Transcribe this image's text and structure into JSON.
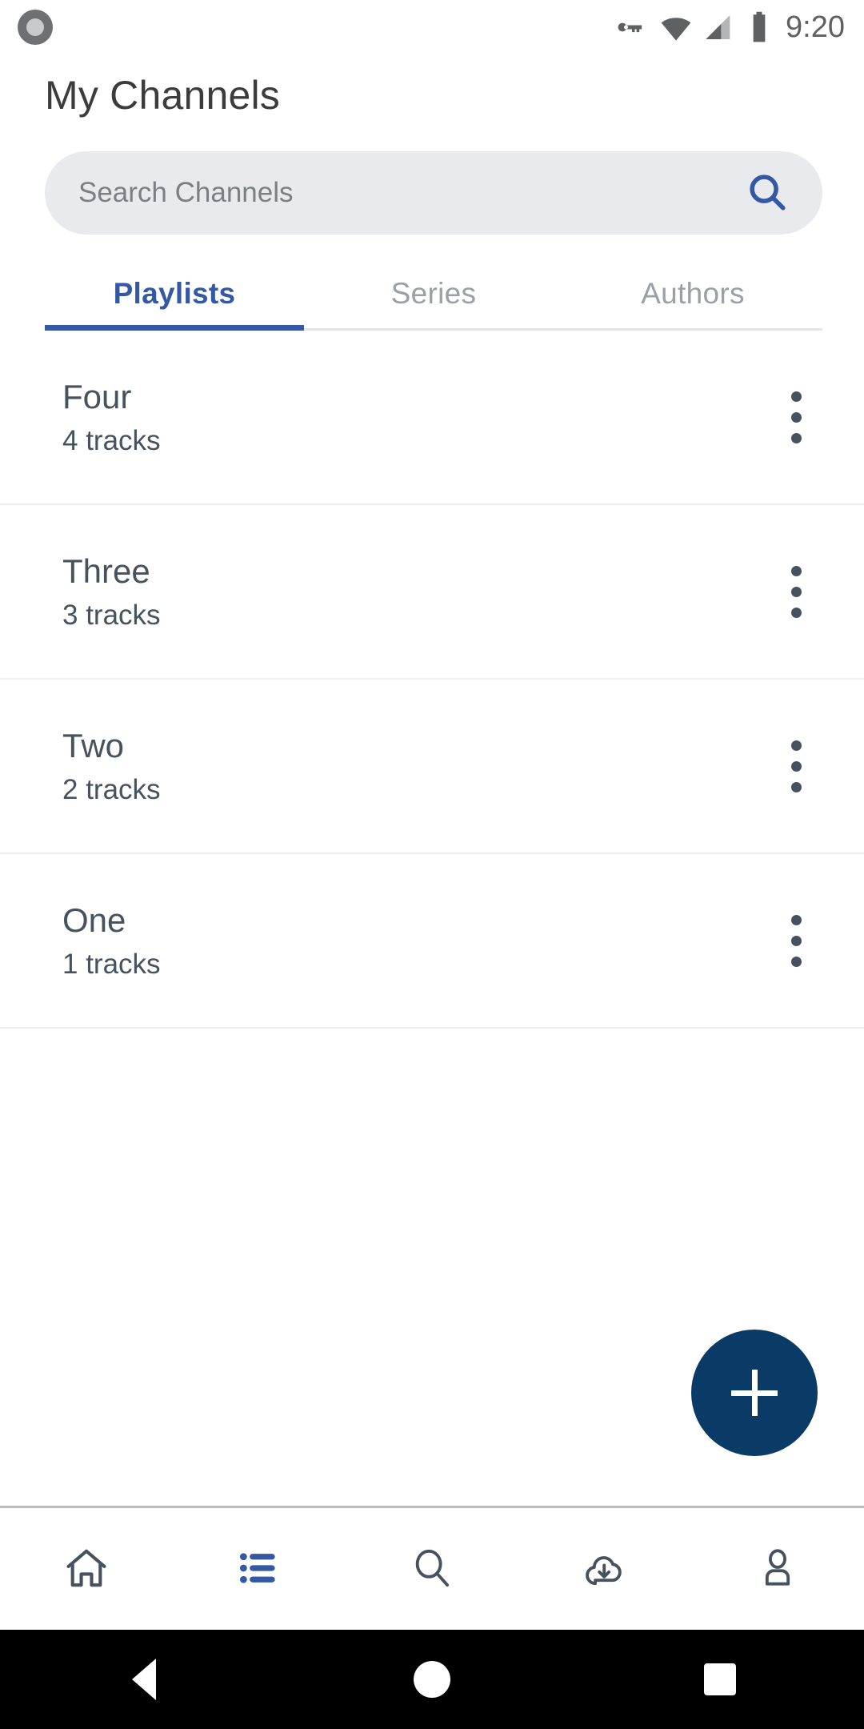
{
  "status_bar": {
    "left_icon": "record-circle-icon",
    "icons": [
      "vpn-key-icon",
      "wifi-icon",
      "cell-signal-icon",
      "battery-icon"
    ],
    "time": "9:20"
  },
  "header": {
    "title": "My Channels"
  },
  "search": {
    "placeholder": "Search Channels",
    "value": "",
    "icon": "search-icon",
    "icon_color": "#3558a4",
    "background": "#e8eaed"
  },
  "tabs": {
    "active_index": 0,
    "accent_color": "#3558a4",
    "items": [
      {
        "label": "Playlists"
      },
      {
        "label": "Series"
      },
      {
        "label": "Authors"
      }
    ]
  },
  "list": {
    "menu_icon": "more-vertical-icon",
    "rows": [
      {
        "title": "Four",
        "subtitle": "4 tracks"
      },
      {
        "title": "Three",
        "subtitle": "3 tracks"
      },
      {
        "title": "Two",
        "subtitle": "2 tracks"
      },
      {
        "title": "One",
        "subtitle": "1 tracks"
      }
    ]
  },
  "fab": {
    "icon": "plus-icon",
    "color": "#0a3a66",
    "label": "Add"
  },
  "bottom_nav": {
    "active_index": 1,
    "active_color": "#3558a4",
    "inactive_color": "#46525e",
    "items": [
      {
        "icon": "home-icon",
        "name": "home"
      },
      {
        "icon": "list-icon",
        "name": "my-channels"
      },
      {
        "icon": "search-icon",
        "name": "search"
      },
      {
        "icon": "cloud-download-icon",
        "name": "downloads"
      },
      {
        "icon": "person-icon",
        "name": "profile"
      }
    ]
  },
  "android_nav": {
    "back": "back-triangle-icon",
    "home": "home-circle-icon",
    "recents": "recents-square-icon"
  }
}
